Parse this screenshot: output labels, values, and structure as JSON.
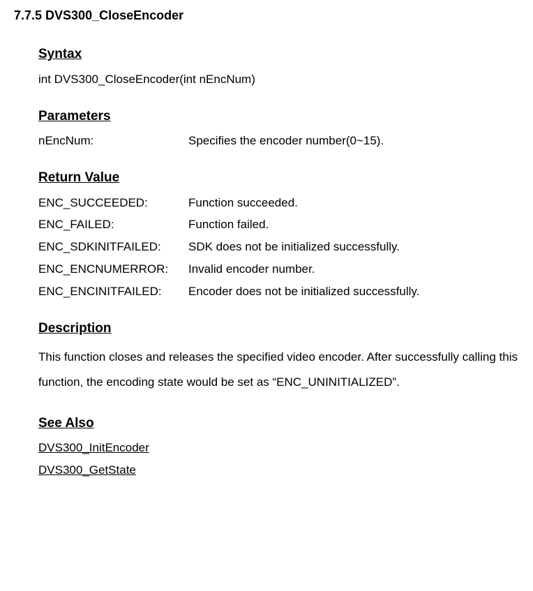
{
  "title": "7.7.5 DVS300_CloseEncoder",
  "syntax": {
    "heading": "Syntax",
    "code": "int DVS300_CloseEncoder(int nEncNum)"
  },
  "parameters": {
    "heading": "Parameters",
    "rows": [
      {
        "term": "nEncNum:",
        "desc": "Specifies the encoder number(0~15)."
      }
    ]
  },
  "return_value": {
    "heading": "Return Value",
    "rows": [
      {
        "term": "ENC_SUCCEEDED:",
        "desc": "Function succeeded."
      },
      {
        "term": "ENC_FAILED:",
        "desc": "Function failed."
      },
      {
        "term": "ENC_SDKINITFAILED:",
        "desc": "SDK does not be initialized successfully."
      },
      {
        "term": "ENC_ENCNUMERROR:",
        "desc": "Invalid encoder number."
      },
      {
        "term": "ENC_ENCINITFAILED:",
        "desc": "Encoder does not be initialized successfully."
      }
    ]
  },
  "description": {
    "heading": "Description",
    "text": "This function closes and releases the specified video encoder. After successfully calling this function, the encoding state would be set as “ENC_UNINITIALIZED”."
  },
  "see_also": {
    "heading": "See Also",
    "links": [
      "DVS300_InitEncoder",
      "DVS300_GetState"
    ]
  }
}
